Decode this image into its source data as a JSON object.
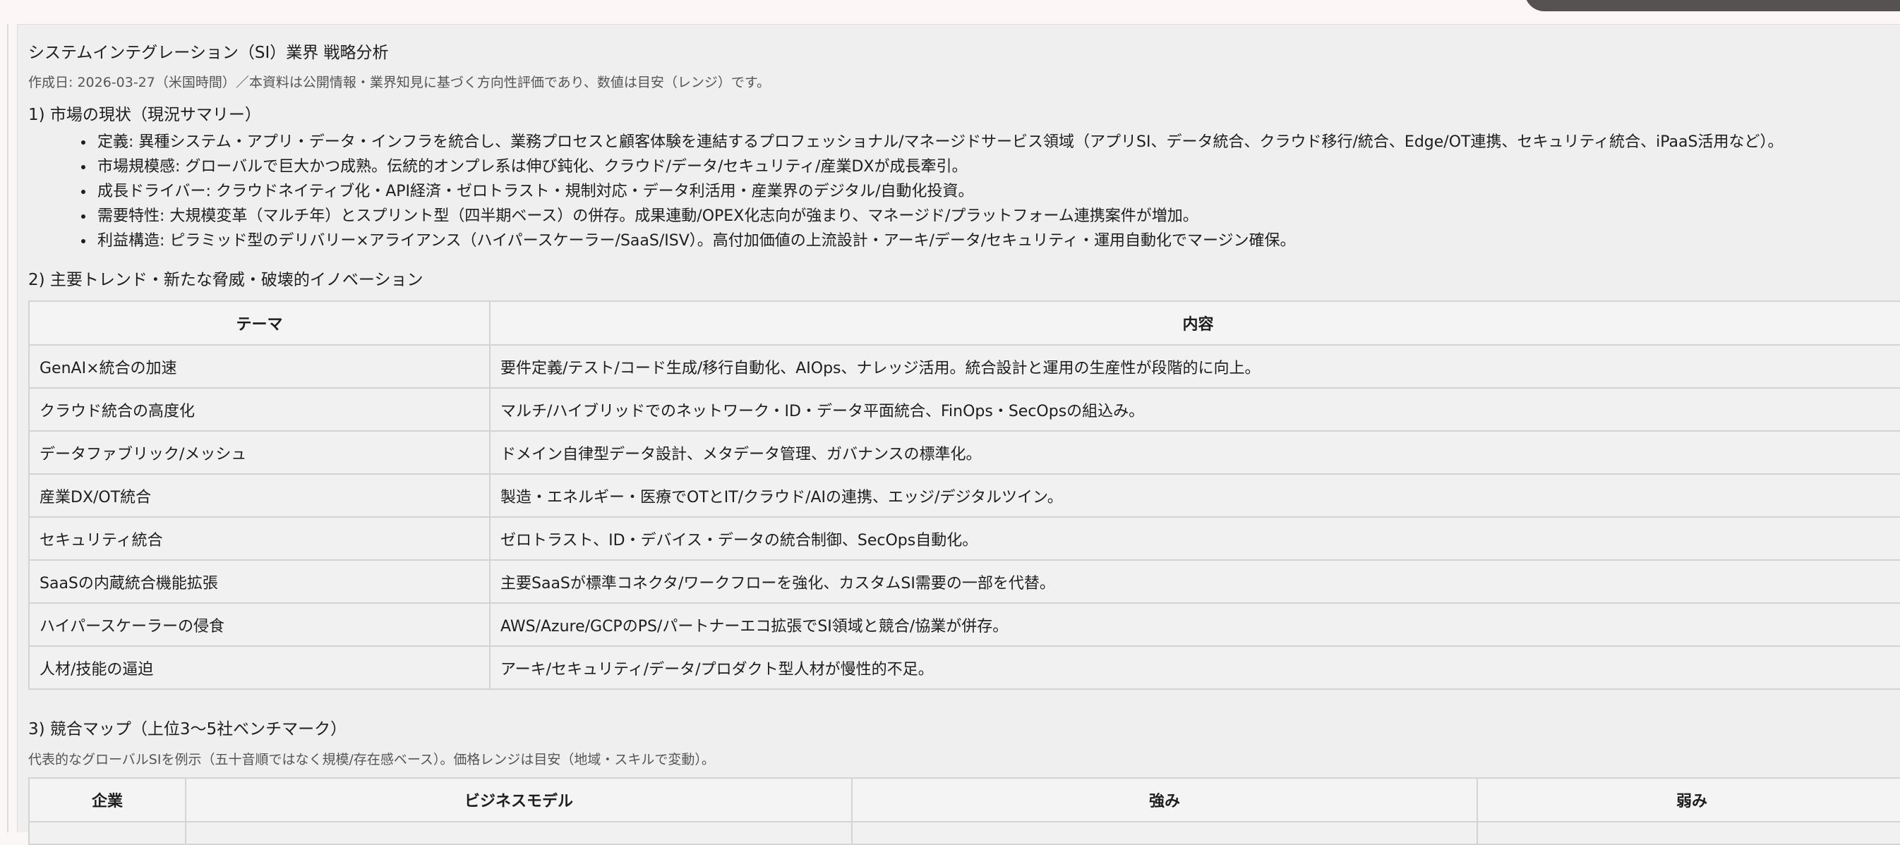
{
  "doc": {
    "title": "システムインテグレーション（SI）業界 戦略分析",
    "meta": "作成日: 2026-03-27（米国時間）／本資料は公開情報・業界知見に基づく方向性評価であり、数値は目安（レンジ）です。"
  },
  "section1": {
    "heading": "1) 市場の現状（現況サマリー）",
    "bullets": [
      "定義: 異種システム・アプリ・データ・インフラを統合し、業務プロセスと顧客体験を連結するプロフェッショナル/マネージドサービス領域（アプリSI、データ統合、クラウド移行/統合、Edge/OT連携、セキュリティ統合、iPaaS活用など）。",
      "市場規模感: グローバルで巨大かつ成熟。伝統的オンプレ系は伸び鈍化、クラウド/データ/セキュリティ/産業DXが成長牽引。",
      "成長ドライバー: クラウドネイティブ化・API経済・ゼロトラスト・規制対応・データ利活用・産業界のデジタル/自動化投資。",
      "需要特性: 大規模変革（マルチ年）とスプリント型（四半期ベース）の併存。成果連動/OPEX化志向が強まり、マネージド/プラットフォーム連携案件が増加。",
      "利益構造: ピラミッド型のデリバリー×アライアンス（ハイパースケーラー/SaaS/ISV）。高付加価値の上流設計・アーキ/データ/セキュリティ・運用自動化でマージン確保。"
    ]
  },
  "section2": {
    "heading": "2) 主要トレンド・新たな脅威・破壊的イノベーション",
    "columns": [
      "テーマ",
      "内容"
    ],
    "rows": [
      [
        "GenAI×統合の加速",
        "要件定義/テスト/コード生成/移行自動化、AIOps、ナレッジ活用。統合設計と運用の生産性が段階的に向上。"
      ],
      [
        "クラウド統合の高度化",
        "マルチ/ハイブリッドでのネットワーク・ID・データ平面統合、FinOps・SecOpsの組込み。"
      ],
      [
        "データファブリック/メッシュ",
        "ドメイン自律型データ設計、メタデータ管理、ガバナンスの標準化。"
      ],
      [
        "産業DX/OT統合",
        "製造・エネルギー・医療でOTとIT/クラウド/AIの連携、エッジ/デジタルツイン。"
      ],
      [
        "セキュリティ統合",
        "ゼロトラスト、ID・デバイス・データの統合制御、SecOps自動化。"
      ],
      [
        "SaaSの内蔵統合機能拡張",
        "主要SaaSが標準コネクタ/ワークフローを強化、カスタムSI需要の一部を代替。"
      ],
      [
        "ハイパースケーラーの侵食",
        "AWS/Azure/GCPのPS/パートナーエコ拡張でSI領域と競合/協業が併存。"
      ],
      [
        "人材/技能の逼迫",
        "アーキ/セキュリティ/データ/プロダクト型人材が慢性的不足。"
      ]
    ]
  },
  "section3": {
    "heading": "3) 競合マップ（上位3〜5社ベンチマーク）",
    "note": "代表的なグローバルSIを例示（五十音順ではなく規模/存在感ベース）。価格レンジは目安（地域・スキルで変動）。",
    "columns": [
      "企業",
      "ビジネスモデル",
      "強み",
      "弱み"
    ]
  }
}
